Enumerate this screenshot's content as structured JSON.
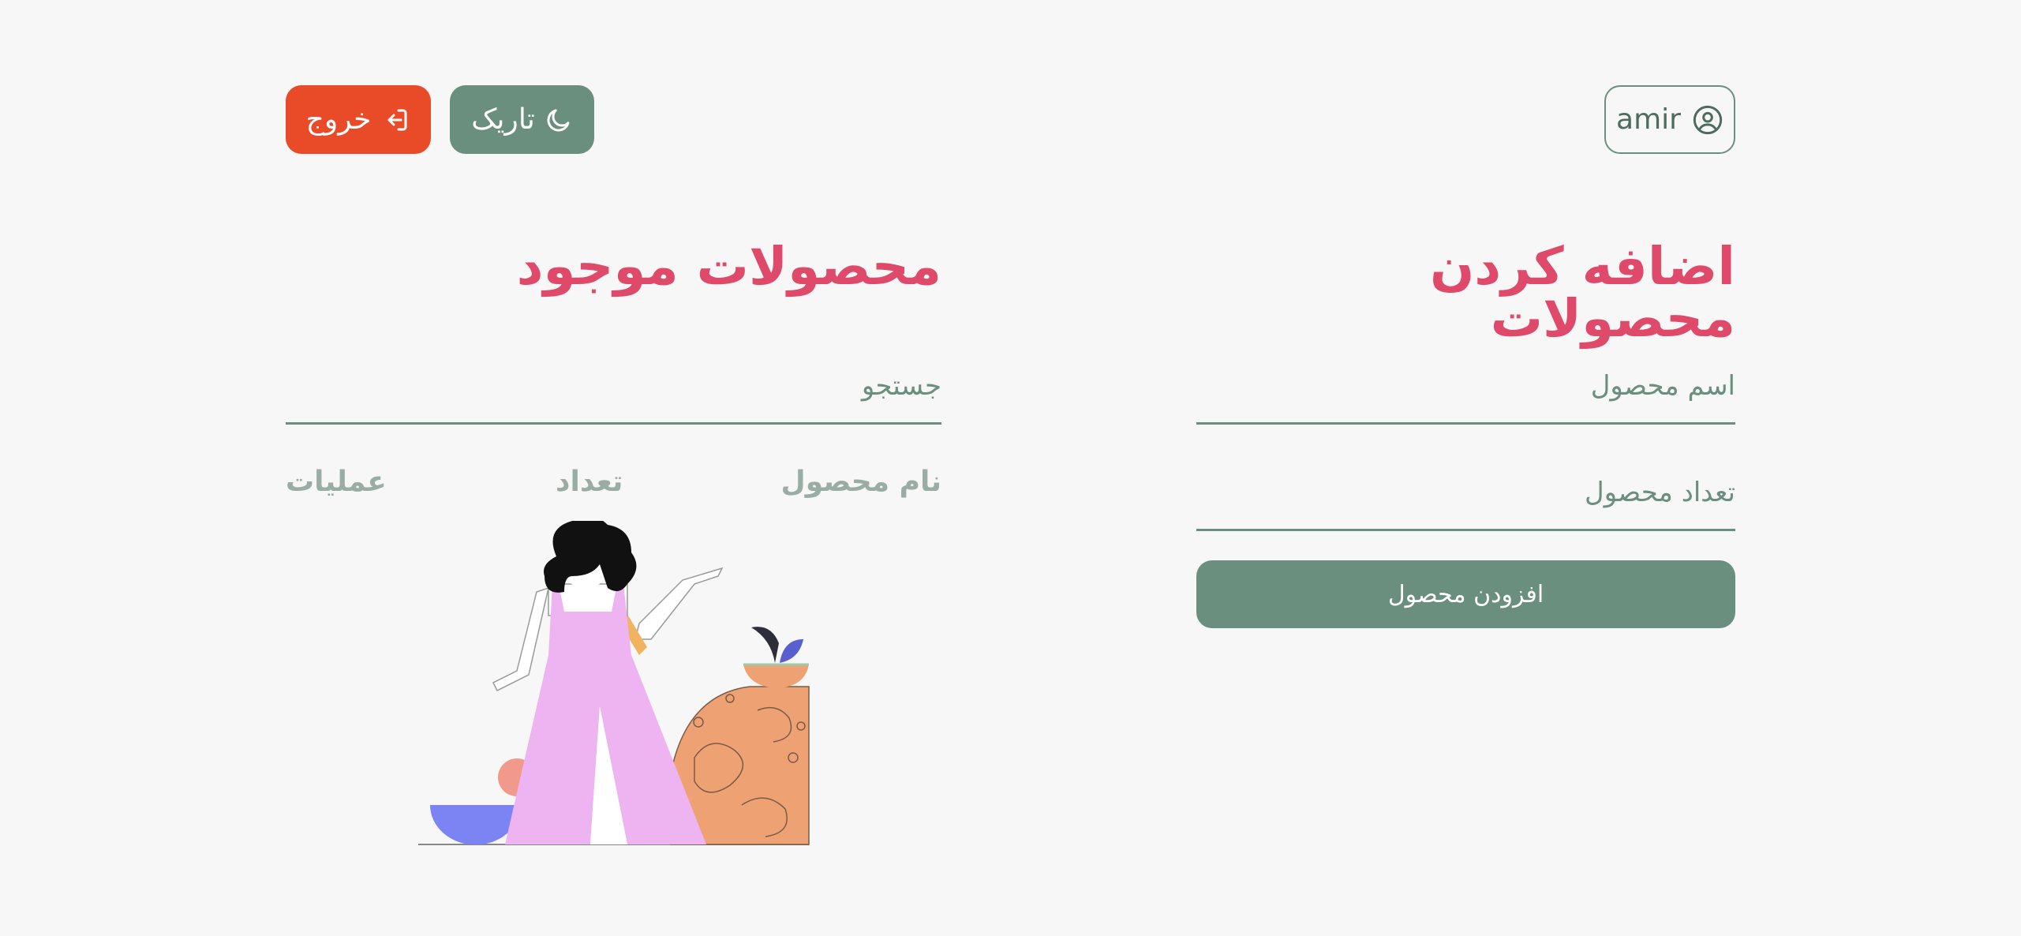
{
  "header": {
    "logout_label": "خروج",
    "theme_label": "تاریک",
    "username": "amir"
  },
  "add_section": {
    "title": "اضافه کردن محصولات",
    "name_placeholder": "اسم محصول",
    "qty_placeholder": "تعداد محصول",
    "submit_label": "افزودن محصول"
  },
  "list_section": {
    "title": "محصولات موجود",
    "search_placeholder": "جستجو",
    "columns": [
      "نام محصول",
      "تعداد",
      "عملیات"
    ]
  },
  "colors": {
    "accent_green": "#6b8f7e",
    "title_pink": "#e04a6a",
    "logout_red": "#e94a27",
    "background": "#f7f7f7"
  },
  "icons": {
    "logout": "logout-icon",
    "theme": "moon-icon",
    "user": "user-circle-icon"
  }
}
